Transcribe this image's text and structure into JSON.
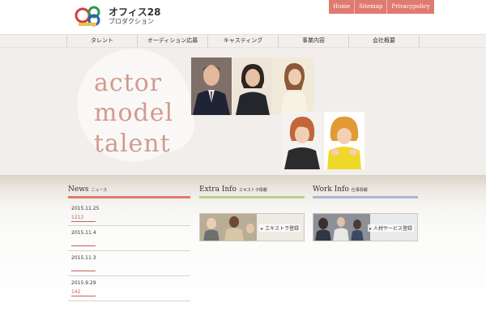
{
  "header": {
    "brand_line1": "オフィス28",
    "brand_line2": "プロダクション",
    "top_links": [
      "Home",
      "Sitemap",
      "Privacypolicy"
    ]
  },
  "nav": {
    "items": [
      "タレント",
      "オーディション応募",
      "キャスティング",
      "事業内容",
      "会社概要"
    ]
  },
  "hero": {
    "lines": [
      "actor",
      "model",
      "talent"
    ]
  },
  "news": {
    "title": "News",
    "subtitle": "ニュース",
    "items": [
      {
        "date": "2015.11.25",
        "title": "1212"
      },
      {
        "date": "2015.11.4",
        "title": ""
      },
      {
        "date": "2015.11.3",
        "title": ""
      },
      {
        "date": "2015.9.29",
        "title": "142"
      }
    ]
  },
  "extra": {
    "title": "Extra Info",
    "subtitle": "エキストラ情報",
    "banner_label": "エキストラ登録"
  },
  "work": {
    "title": "Work Info",
    "subtitle": "仕事情報",
    "banner_label": "人材サービス登録"
  },
  "colors": {
    "accent": "#e07a70",
    "news_rule": "#e07a70",
    "extra_rule": "#b7d08a",
    "work_rule": "#a7b8d2",
    "hero_text": "#d39a8e"
  },
  "icons": {
    "logo": "office28-logo",
    "banner_arrow": "arrow-icon"
  }
}
